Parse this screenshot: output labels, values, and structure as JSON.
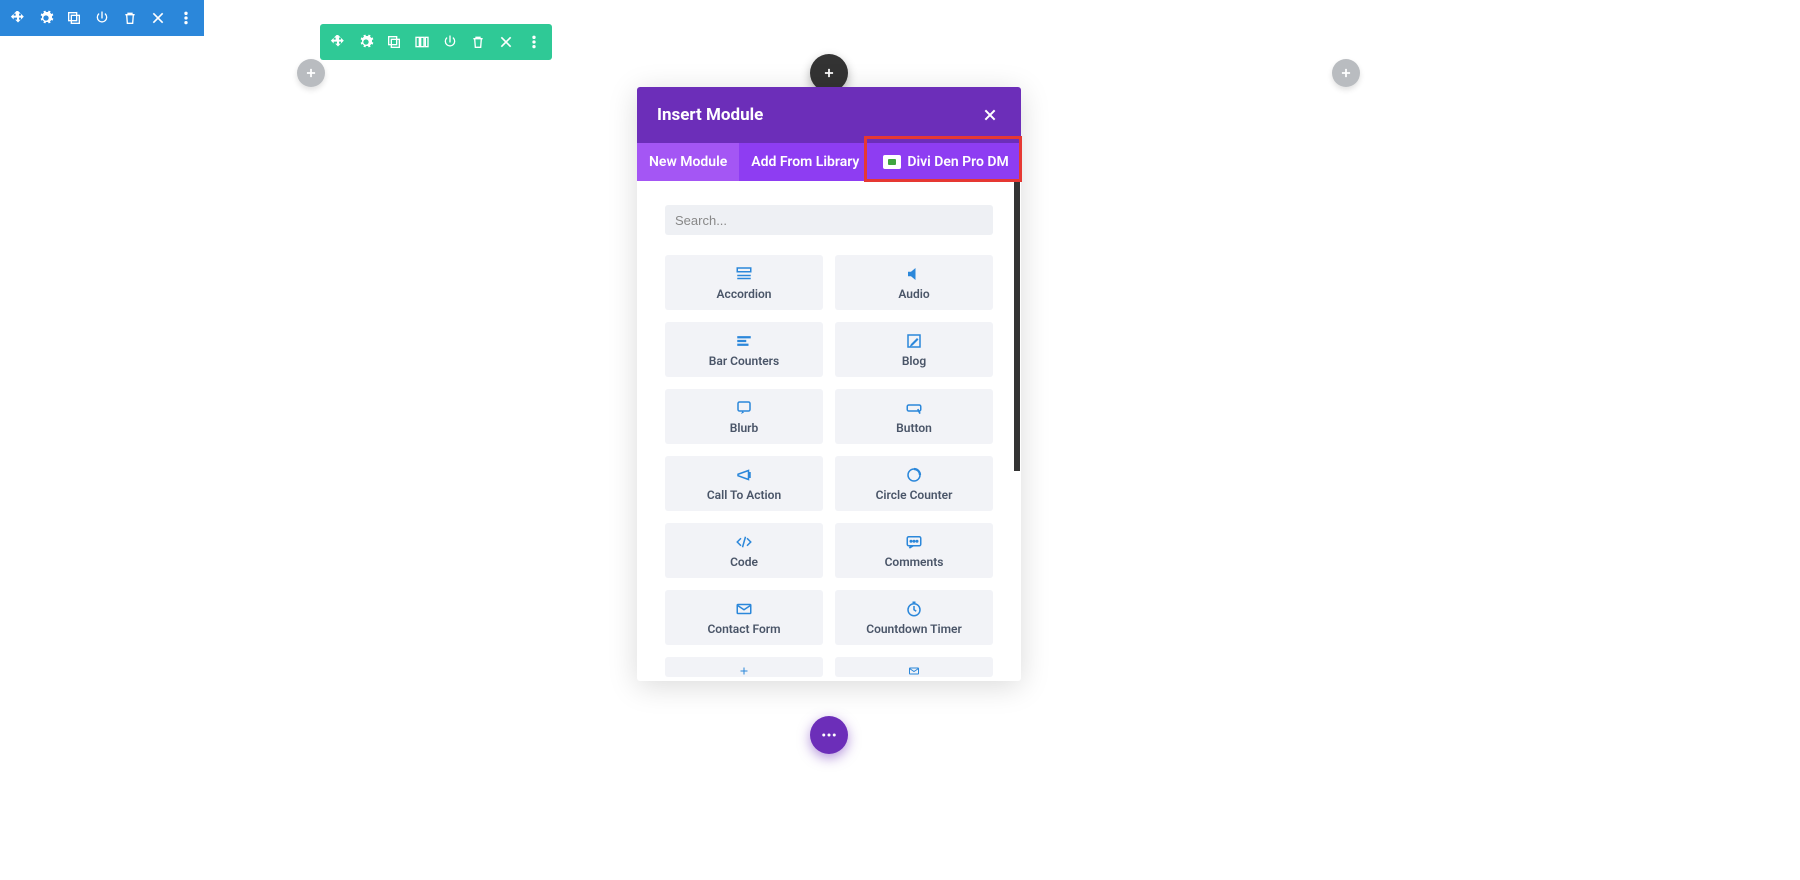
{
  "blue_toolbar": {
    "icons": [
      "move",
      "gear",
      "duplicate",
      "power",
      "trash",
      "close",
      "more"
    ]
  },
  "green_toolbar": {
    "icons": [
      "move",
      "gear",
      "duplicate",
      "columns",
      "power",
      "trash",
      "close",
      "more"
    ]
  },
  "modal": {
    "title": "Insert Module",
    "tabs": [
      {
        "label": "New Module",
        "active": true
      },
      {
        "label": "Add From Library",
        "active": false
      },
      {
        "label": "Divi Den Pro DM",
        "active": false,
        "highlighted": true
      }
    ],
    "search_placeholder": "Search...",
    "modules": [
      {
        "label": "Accordion",
        "icon": "accordion"
      },
      {
        "label": "Audio",
        "icon": "audio"
      },
      {
        "label": "Bar Counters",
        "icon": "bars"
      },
      {
        "label": "Blog",
        "icon": "blog"
      },
      {
        "label": "Blurb",
        "icon": "blurb"
      },
      {
        "label": "Button",
        "icon": "button"
      },
      {
        "label": "Call To Action",
        "icon": "cta"
      },
      {
        "label": "Circle Counter",
        "icon": "circle"
      },
      {
        "label": "Code",
        "icon": "code"
      },
      {
        "label": "Comments",
        "icon": "comments"
      },
      {
        "label": "Contact Form",
        "icon": "mail"
      },
      {
        "label": "Countdown Timer",
        "icon": "clock"
      },
      {
        "label": "",
        "icon": "plus-partial"
      },
      {
        "label": "",
        "icon": "mail-partial"
      }
    ]
  },
  "colors": {
    "blue": "#2b87da",
    "green": "#2fc996",
    "purple": "#6c2eb9",
    "purple_light": "#8e3df2",
    "purple_active": "#a456f4",
    "red": "#e63832"
  }
}
